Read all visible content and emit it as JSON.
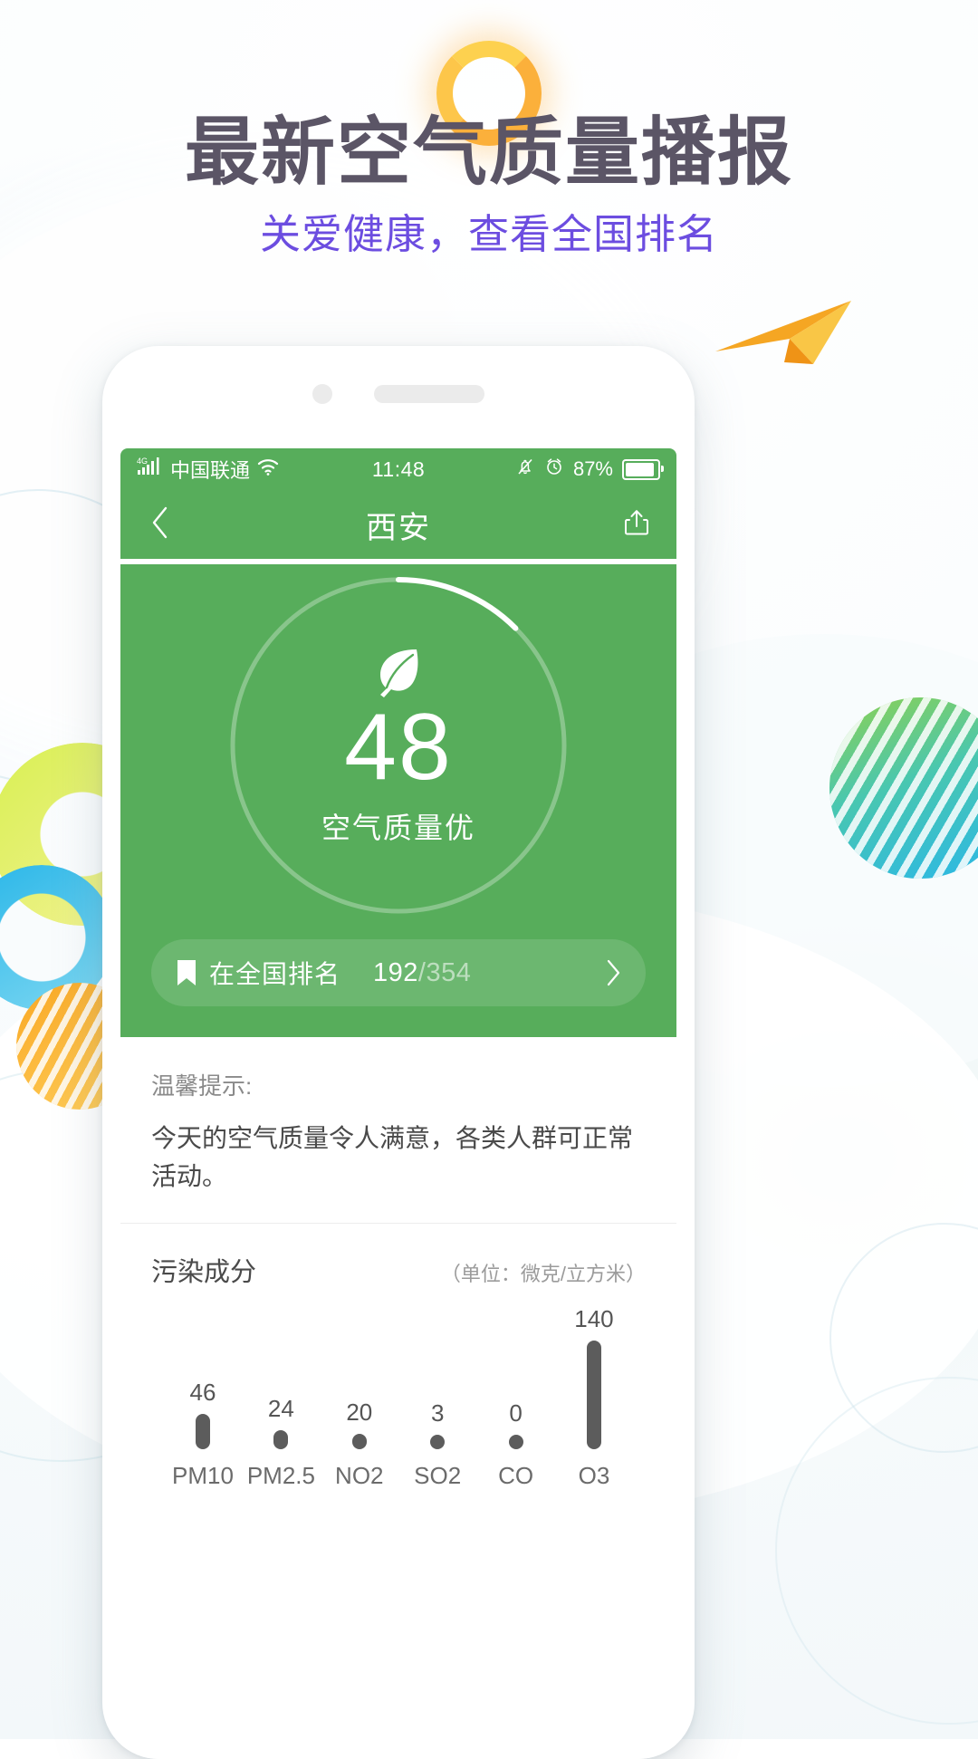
{
  "promo": {
    "sun_icon": "sun-ring-icon",
    "headline": "最新空气质量播报",
    "subhead": "关爱健康，查看全国排名",
    "headline_color": "#5b5566",
    "subhead_color": "#6c4de0"
  },
  "phone": {
    "statusbar": {
      "network_badge": "4G",
      "signal_icon": "signal-bars-icon",
      "carrier": "中国联通",
      "wifi_icon": "wifi-icon",
      "time": "11:48",
      "mute_icon": "bell-muted-icon",
      "alarm_icon": "alarm-clock-icon",
      "battery_percent": "87%",
      "battery_icon": "battery-icon"
    },
    "navbar": {
      "back_icon": "chevron-left-icon",
      "title": "西安",
      "share_icon": "share-icon"
    },
    "hero": {
      "accent_color": "#57ad5b",
      "leaf_icon": "leaf-icon",
      "aqi_value": "48",
      "aqi_label": "空气质量优",
      "gauge_max": "500",
      "rank": {
        "bookmark_icon": "bookmark-icon",
        "label": "在全国排名",
        "numerator": "192",
        "separator": "/",
        "denominator": "354",
        "chevron_icon": "chevron-right-icon"
      }
    },
    "tips": {
      "title": "温馨提示:",
      "body": "今天的空气质量令人满意，各类人群可正常活动。"
    },
    "pollution": {
      "title": "污染成分",
      "unit": "（单位：微克/立方米）"
    }
  },
  "chart_data": {
    "type": "bar",
    "title": "污染成分",
    "xlabel": "",
    "ylabel": "微克/立方米",
    "categories": [
      "PM10",
      "PM2.5",
      "NO2",
      "SO2",
      "CO",
      "O3"
    ],
    "values": [
      46,
      24,
      20,
      3,
      0,
      140
    ],
    "ylim": [
      0,
      140
    ],
    "grid": false,
    "legend": false,
    "bar_color": "#5c5c5c",
    "orientation": "vertical"
  }
}
